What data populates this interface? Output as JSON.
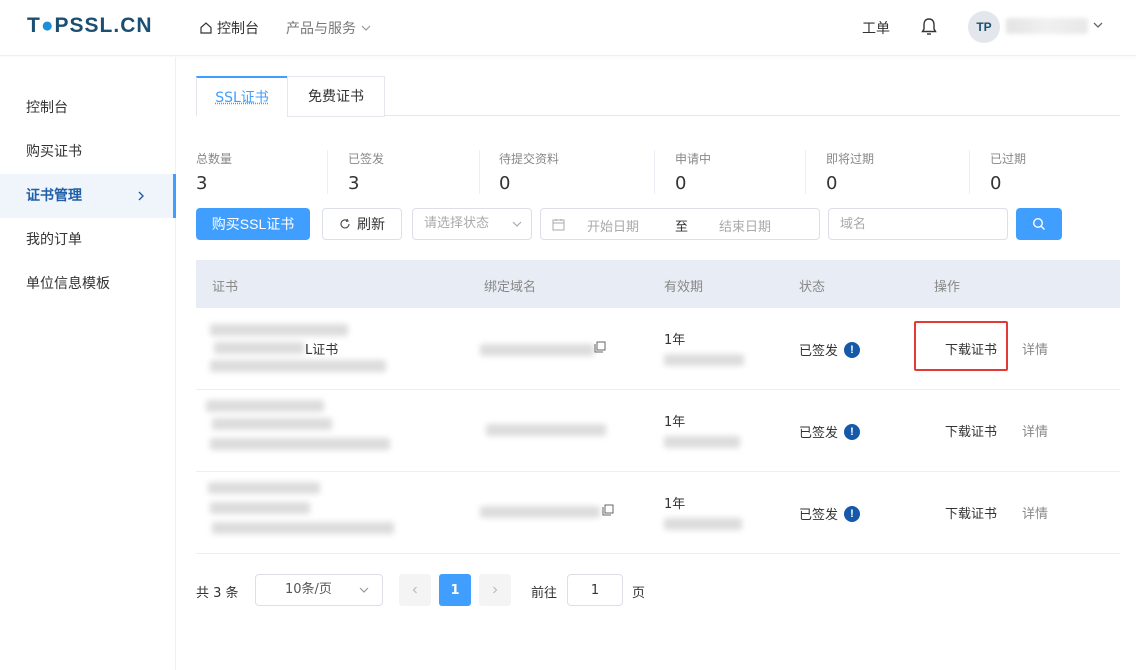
{
  "header": {
    "logo_text": "T●PSSL.CN",
    "nav": {
      "dashboard": "控制台",
      "products": "产品与服务"
    },
    "ticket": "工单",
    "avatar_text": "TP"
  },
  "sidebar": {
    "items": [
      {
        "label": "控制台"
      },
      {
        "label": "购买证书"
      },
      {
        "label": "证书管理"
      },
      {
        "label": "我的订单"
      },
      {
        "label": "单位信息模板"
      }
    ]
  },
  "tabs": [
    {
      "label": "SSL证书"
    },
    {
      "label": "免费证书"
    }
  ],
  "stats": [
    {
      "label": "总数量",
      "value": "3"
    },
    {
      "label": "已签发",
      "value": "3"
    },
    {
      "label": "待提交资料",
      "value": "0"
    },
    {
      "label": "申请中",
      "value": "0"
    },
    {
      "label": "即将过期",
      "value": "0"
    },
    {
      "label": "已过期",
      "value": "0"
    }
  ],
  "toolbar": {
    "buy_label": "购买SSL证书",
    "refresh_label": "刷新",
    "status_placeholder": "请选择状态",
    "start_date_placeholder": "开始日期",
    "range_separator": "至",
    "end_date_placeholder": "结束日期",
    "domain_placeholder": "域名"
  },
  "table": {
    "headers": [
      "证书",
      "绑定域名",
      "有效期",
      "状态",
      "操作"
    ],
    "rows": [
      {
        "cert_fragment": "L证书",
        "validity": "1年",
        "status": "已签发",
        "download": "下载证书",
        "detail": "详情"
      },
      {
        "cert_fragment": "",
        "validity": "1年",
        "status": "已签发",
        "download": "下载证书",
        "detail": "详情"
      },
      {
        "cert_fragment": "",
        "validity": "1年",
        "status": "已签发",
        "download": "下载证书",
        "detail": "详情"
      }
    ]
  },
  "pagination": {
    "total": "共 3 条",
    "page_size": "10条/页",
    "current_page": "1",
    "goto_label": "前往",
    "goto_value": "1",
    "page_suffix": "页"
  },
  "colors": {
    "primary": "#409eff",
    "logo_dark": "#1a4f73",
    "status_icon": "#1559a8",
    "highlight": "#e53935"
  }
}
